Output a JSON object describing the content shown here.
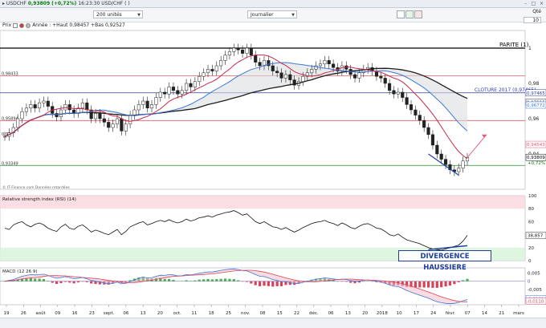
{
  "window": {
    "title": "USDCHF",
    "price": "0,93809",
    "change": "+0,72%",
    "time": "16:23:30 USD/CHF ( )"
  },
  "toolbar": {
    "units": "200 unités",
    "period": "Journalier",
    "qte_label": "Qté",
    "qte_value": "10"
  },
  "legend": {
    "prix": "Prix",
    "year_label": "Année : +Haut 0,98457 +Bas 0,92527"
  },
  "labels": {
    "parite": "PARITE (1)",
    "cloture": "CLOTURE 2017 (0,97465)",
    "copyright": "© IT-Finance.com Données retardées",
    "rsi_title": "Relative strength index (RSI) (14)",
    "macd_title": "MACD (12 26 9)",
    "divergence": "DIVERGENCE HAUSSIERE",
    "left_lvl1": "0,98433",
    "left_lvl2": "0,95894",
    "left_lvl3": "0,95",
    "left_lvl4": "0,93349"
  },
  "axis_main": {
    "ticks": [
      "1",
      "0,98",
      "0,96",
      "0,94"
    ],
    "badges": [
      "0,97465",
      "0,97116",
      "0,96772",
      "0,94543",
      "0,93809",
      "+0,72%"
    ]
  },
  "axis_rsi": {
    "ticks": [
      "100",
      "80",
      "60",
      "40",
      "20",
      "0"
    ],
    "badge": "38,857"
  },
  "axis_macd": {
    "ticks": [
      "0,005",
      "-0,005"
    ],
    "badges": [
      "0",
      "-0,0109",
      "-0,0110"
    ]
  },
  "x_axis": {
    "labels": [
      "19",
      "26",
      "août",
      "09",
      "16",
      "23",
      "sept.",
      "06",
      "13",
      "20",
      "oct.",
      "11",
      "18",
      "25",
      "nov.",
      "08",
      "15",
      "22",
      "déc.",
      "06",
      "13",
      "20",
      "2018",
      "10",
      "17",
      "24",
      "févr.",
      "07",
      "14",
      "21",
      "mars"
    ]
  },
  "colors": {
    "parite": "#000000",
    "cloture": "#2a3fa0",
    "ma_short": "#c8284a",
    "ma_mid": "#3a78d8",
    "ma_long": "#1e1e1e",
    "level_red": "#e05a6a",
    "level_green": "#4a9e4a",
    "divergence": "#1f3f9e"
  },
  "chart_data": {
    "type": "candlestick",
    "ylim": [
      0.92,
      1.01
    ],
    "candles_close": [
      0.95,
      0.952,
      0.955,
      0.96,
      0.964,
      0.966,
      0.968,
      0.966,
      0.969,
      0.97,
      0.967,
      0.963,
      0.961,
      0.965,
      0.968,
      0.965,
      0.963,
      0.966,
      0.969,
      0.965,
      0.96,
      0.963,
      0.96,
      0.958,
      0.955,
      0.957,
      0.96,
      0.953,
      0.957,
      0.962,
      0.965,
      0.968,
      0.97,
      0.966,
      0.968,
      0.972,
      0.975,
      0.974,
      0.978,
      0.976,
      0.974,
      0.976,
      0.98,
      0.978,
      0.981,
      0.984,
      0.986,
      0.988,
      0.987,
      0.99,
      0.993,
      0.996,
      0.998,
      1.0,
      0.999,
      0.997,
      1.0,
      0.996,
      0.992,
      0.99,
      0.993,
      0.99,
      0.987,
      0.986,
      0.983,
      0.985,
      0.982,
      0.979,
      0.981,
      0.984,
      0.986,
      0.988,
      0.99,
      0.991,
      0.993,
      0.991,
      0.989,
      0.987,
      0.99,
      0.988,
      0.985,
      0.983,
      0.986,
      0.988,
      0.989,
      0.987,
      0.984,
      0.983,
      0.98,
      0.976,
      0.974,
      0.975,
      0.972,
      0.968,
      0.965,
      0.962,
      0.959,
      0.955,
      0.951,
      0.945,
      0.94,
      0.937,
      0.934,
      0.931,
      0.93,
      0.932,
      0.936,
      0.938
    ],
    "rsi": [
      50,
      48,
      55,
      58,
      60,
      55,
      52,
      56,
      58,
      55,
      50,
      47,
      45,
      52,
      56,
      50,
      48,
      53,
      55,
      50,
      44,
      47,
      45,
      42,
      40,
      44,
      48,
      40,
      45,
      52,
      55,
      58,
      60,
      55,
      57,
      60,
      62,
      60,
      63,
      60,
      58,
      60,
      64,
      61,
      63,
      66,
      67,
      69,
      67,
      70,
      72,
      74,
      75,
      77,
      74,
      70,
      72,
      66,
      60,
      57,
      60,
      56,
      52,
      51,
      48,
      51,
      47,
      44,
      47,
      51,
      54,
      57,
      59,
      60,
      62,
      59,
      57,
      54,
      58,
      55,
      51,
      49,
      53,
      56,
      57,
      54,
      50,
      49,
      45,
      40,
      38,
      41,
      36,
      32,
      30,
      28,
      26,
      23,
      20,
      18,
      17,
      16,
      18,
      20,
      22,
      24,
      30,
      38.857
    ],
    "macd": [
      0.0,
      0.0005,
      0.001,
      0.002,
      0.003,
      0.0035,
      0.004,
      0.0038,
      0.004,
      0.0042,
      0.0035,
      0.0025,
      0.0018,
      0.0022,
      0.0028,
      0.0022,
      0.0015,
      0.0018,
      0.0022,
      0.0015,
      0.0005,
      0.0,
      -0.0005,
      -0.001,
      -0.0015,
      -0.0012,
      -0.0005,
      -0.0015,
      -0.0012,
      -0.0002,
      0.0008,
      0.0018,
      0.0025,
      0.002,
      0.0022,
      0.003,
      0.0036,
      0.0035,
      0.004,
      0.0038,
      0.0032,
      0.0033,
      0.004,
      0.0038,
      0.0042,
      0.0048,
      0.0052,
      0.0056,
      0.0055,
      0.006,
      0.0065,
      0.007,
      0.0072,
      0.0074,
      0.007,
      0.0064,
      0.0062,
      0.0052,
      0.004,
      0.003,
      0.0028,
      0.002,
      0.001,
      0.0005,
      -0.0002,
      -0.0002,
      -0.0008,
      -0.0014,
      -0.0012,
      -0.0006,
      0.0,
      0.0006,
      0.0012,
      0.0016,
      0.002,
      0.0018,
      0.0014,
      0.001,
      0.0012,
      0.001,
      0.0004,
      0.0,
      0.0002,
      0.0006,
      0.0008,
      0.0006,
      0.0,
      -0.0004,
      -0.0012,
      -0.0022,
      -0.003,
      -0.0032,
      -0.0042,
      -0.0055,
      -0.0065,
      -0.0074,
      -0.0083,
      -0.0092,
      -0.0101,
      -0.0112,
      -0.0122,
      -0.0128,
      -0.0132,
      -0.0134,
      -0.0132,
      -0.0126,
      -0.0116,
      -0.0109
    ]
  }
}
